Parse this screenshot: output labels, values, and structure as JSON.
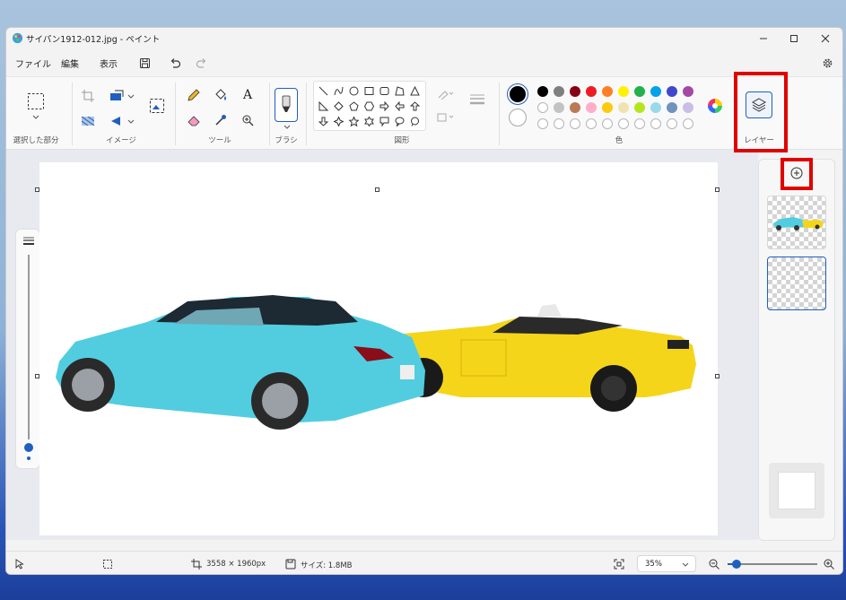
{
  "window": {
    "title": "サイパン1912-012.jpg - ペイント"
  },
  "menu": {
    "file": "ファイル",
    "edit": "編集",
    "view": "表示"
  },
  "ribbon": {
    "groups": {
      "selection": "選択した部分",
      "image": "イメージ",
      "tools": "ツール",
      "brush": "ブラシ",
      "shapes": "図形",
      "colors": "色",
      "layers": "レイヤー"
    },
    "text_tool_glyph": "A",
    "primary_color": "#000000",
    "secondary_color": "#ffffff",
    "palette_row1": [
      "#000000",
      "#7f7f7f",
      "#880015",
      "#ed1c24",
      "#ff7f27",
      "#fff200",
      "#22b14c",
      "#00a2e8",
      "#3f48cc",
      "#a349a4"
    ],
    "palette_row2": [
      "#ffffff",
      "#c3c3c3",
      "#b97a57",
      "#ffaec9",
      "#ffc90e",
      "#efe4b0",
      "#b5e61d",
      "#99d9ea",
      "#7092be",
      "#c8bfe7"
    ]
  },
  "status": {
    "dimensions": "3558 × 1960px",
    "size": "サイズ: 1.8MB",
    "zoom": "35%",
    "zoom_level_fraction": 0.1
  }
}
